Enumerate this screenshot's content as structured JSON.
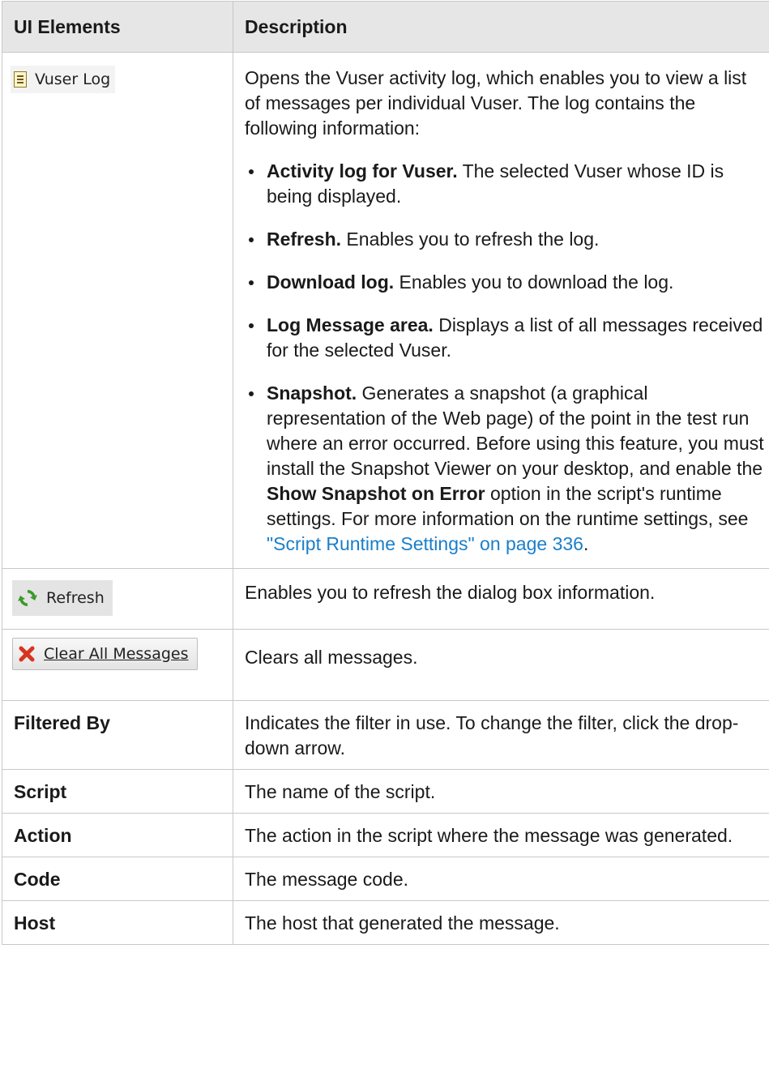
{
  "headers": {
    "col1": "UI Elements",
    "col2": "Description"
  },
  "vuser_log": {
    "button_label": "Vuser Log",
    "intro": "Opens the Vuser activity log, which enables you to view a list of messages per individual Vuser. The log contains the following information:",
    "items": [
      {
        "term": "Activity log for Vuser.",
        "text": " The selected Vuser whose ID is being displayed."
      },
      {
        "term": "Refresh.",
        "text": " Enables you to refresh the log."
      },
      {
        "term": "Download log.",
        "text": " Enables you to download the log."
      },
      {
        "term": "Log Message area.",
        "text": " Displays a list of all messages received for the selected Vuser."
      }
    ],
    "snapshot": {
      "term": "Snapshot.",
      "text1": " Generates a snapshot (a graphical representation of the Web page) of the point in the test run where an error occurred. Before using this feature, you must install the Snapshot Viewer on your desktop, and enable the ",
      "bold2": "Show Snapshot on Error",
      "text2": " option in the script's runtime settings. For more information on the runtime settings, see ",
      "link": "\"Script Runtime Settings\" on page 336",
      "end": "."
    }
  },
  "refresh": {
    "button_label": "Refresh",
    "description": "Enables you to refresh the dialog box information."
  },
  "clear": {
    "button_label": "Clear All Messages",
    "description": "Clears all messages."
  },
  "rows": [
    {
      "label": "Filtered By",
      "description": "Indicates the filter in use. To change the filter, click the drop-down arrow."
    },
    {
      "label": "Script",
      "description": "The name of the script."
    },
    {
      "label": "Action",
      "description": "The action in the script where the message was generated."
    },
    {
      "label": "Code",
      "description": "The message code."
    },
    {
      "label": "Host",
      "description": "The host that generated the message."
    }
  ],
  "colors": {
    "header_bg": "#e6e6e6",
    "border": "#c8c8c8",
    "link": "#1a7fc9"
  },
  "icons": {
    "vuser_log": "log-icon",
    "refresh": "refresh-icon",
    "clear": "red-x-icon"
  }
}
